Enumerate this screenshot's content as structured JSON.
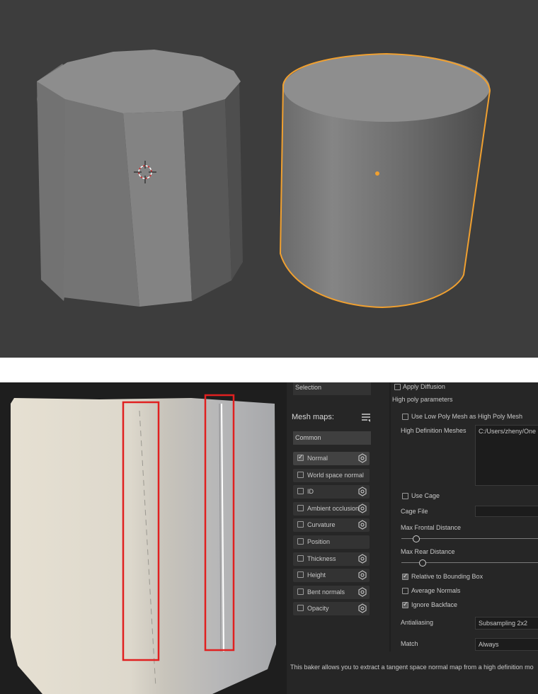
{
  "viewport": {
    "background": "#3d3d3d",
    "selection_outline_color": "#f0a030"
  },
  "baker": {
    "selection_label": "Selection",
    "apply_diffusion": "Apply Diffusion",
    "high_poly_header": "High poly parameters",
    "mesh_maps_title": "Mesh maps:",
    "group_label": "Common",
    "maps": [
      {
        "label": "Normal",
        "checked": true,
        "icon": "gear-icon"
      },
      {
        "label": "World space normal",
        "checked": false,
        "icon": ""
      },
      {
        "label": "ID",
        "checked": false,
        "icon": "gear-icon"
      },
      {
        "label": "Ambient occlusion",
        "checked": false,
        "icon": "gear-icon"
      },
      {
        "label": "Curvature",
        "checked": false,
        "icon": "gear-icon"
      },
      {
        "label": "Position",
        "checked": false,
        "icon": ""
      },
      {
        "label": "Thickness",
        "checked": false,
        "icon": "gear-icon"
      },
      {
        "label": "Height",
        "checked": false,
        "icon": "gear-icon"
      },
      {
        "label": "Bent normals",
        "checked": false,
        "icon": "gear-icon"
      },
      {
        "label": "Opacity",
        "checked": false,
        "icon": "gear-icon"
      }
    ],
    "use_low_poly": "Use Low Poly Mesh as High Poly Mesh",
    "hd_meshes_label": "High Definition Meshes",
    "hd_meshes_value": "C:/Users/zheny/One",
    "use_cage": "Use Cage",
    "cage_file": "Cage File",
    "max_frontal": "Max Frontal Distance",
    "max_frontal_value": 0.1,
    "max_rear": "Max Rear Distance",
    "max_rear_value": 0.15,
    "relative_bbox": "Relative to Bounding Box",
    "average_normals": "Average Normals",
    "ignore_backface": "Ignore Backface",
    "antialiasing_label": "Antialiasing",
    "antialiasing_value": "Subsampling 2x2",
    "match_label": "Match",
    "match_value": "Always",
    "description": "This baker allows you to extract a tangent space normal map from a high definition mo"
  }
}
